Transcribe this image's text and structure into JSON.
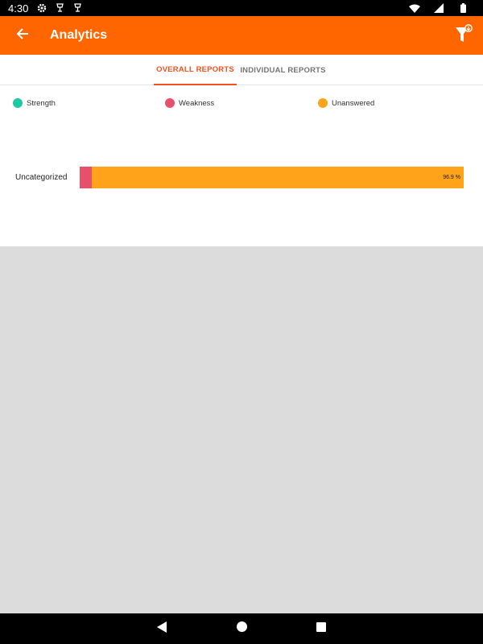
{
  "status_bar": {
    "time": "4:30",
    "left_icons": [
      "settings-icon",
      "notification-icon",
      "notification-icon"
    ],
    "right_icons": [
      "wifi-icon",
      "signal-icon",
      "battery-icon"
    ]
  },
  "app_bar": {
    "title": "Analytics",
    "color": "#ff6600",
    "back_icon": "arrow-back-icon",
    "filter_icon": "filter-icon"
  },
  "tabs": [
    {
      "label": "OVERALL REPORTS",
      "active": true
    },
    {
      "label": "INDIVIDUAL REPORTS",
      "active": false
    }
  ],
  "legend": [
    {
      "label": "Strength",
      "color": "#1fc8a0"
    },
    {
      "label": "Weakness",
      "color": "#e8506a"
    },
    {
      "label": "Unanswered",
      "color": "#ffa31a"
    }
  ],
  "chart_data": {
    "type": "bar",
    "orientation": "horizontal",
    "stacked": true,
    "categories": [
      "Uncategorized"
    ],
    "series": [
      {
        "name": "Strength",
        "values": [
          0
        ],
        "color": "#1fc8a0"
      },
      {
        "name": "Weakness",
        "values": [
          3.1
        ],
        "color": "#e8506a"
      },
      {
        "name": "Unanswered",
        "values": [
          96.9
        ],
        "color": "#ffa31a"
      }
    ],
    "data_labels": [
      "96.9 %"
    ],
    "legend_position": "top"
  },
  "nav_bar": {
    "icons": [
      "nav-back-icon",
      "nav-home-icon",
      "nav-recents-icon"
    ]
  }
}
